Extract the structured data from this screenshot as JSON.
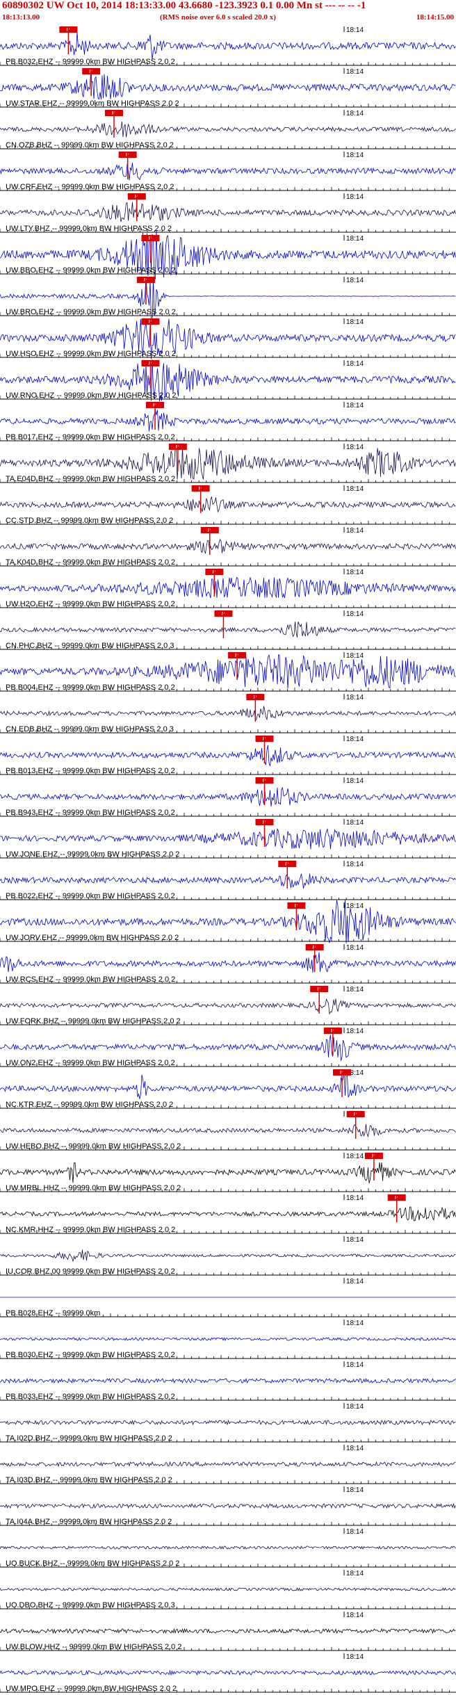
{
  "header": {
    "title": "60890302 UW Oct 10, 2014 18:13:33.00   43.6680 -123.3923  0.1 0.00 Mn st --- -- --  -1",
    "start_time": "18:13:13.00",
    "end_time": "18:14:15.00",
    "subtitle": "(RMS noise over 6.0 s scaled 20.0 x)"
  },
  "colors": {
    "trace_blue": "#0000cc",
    "trace_dark": "#1a0a4a",
    "trace_black": "#000000",
    "pick_marker": "#dd0000",
    "title": "#cc0000"
  },
  "chart_data": {
    "type": "line",
    "x_range": [
      "18:13:13.00",
      "18:14:15.00"
    ],
    "tick_label": "18:14",
    "pick_label": "P",
    "channels": [
      {
        "label": "PB.B032.EHZ -- 99999.0km BW  HIGHPASS  2.0  2",
        "color": "blue",
        "amp": 5,
        "pick": 0.15,
        "events": [
          [
            0.17,
            0.02,
            16
          ],
          [
            0.33,
            0.02,
            16
          ]
        ]
      },
      {
        "label": "UW.STAR.EHZ -- 99999.0km BW  HIGHPASS  2.0  2",
        "color": "blue",
        "amp": 5,
        "pick": 0.2,
        "events": [
          [
            0.22,
            0.05,
            20
          ]
        ]
      },
      {
        "label": "CN.OZB.BHZ -- 99999.0km BW  HIGHPASS  2.0  2",
        "color": "dark",
        "amp": 3,
        "pick": 0.25,
        "events": [
          [
            0.27,
            0.06,
            10
          ]
        ]
      },
      {
        "label": "UW.CRF.EHZ -- 99999.0km BW  HIGHPASS  2.0  2",
        "color": "blue",
        "amp": 4,
        "pick": 0.28,
        "events": [
          [
            0.29,
            0.04,
            10
          ]
        ]
      },
      {
        "label": "UW.LTY.BHZ -- 99999.0km BW  HIGHPASS  2.0  2",
        "color": "dark",
        "amp": 4,
        "pick": 0.3,
        "events": [
          [
            0.3,
            0.08,
            12
          ]
        ]
      },
      {
        "label": "UW.BBO.EHZ -- 99999.0km BW  HIGHPASS  2.0  2",
        "color": "blue",
        "amp": 6,
        "pick": 0.33,
        "events": [
          [
            0.35,
            0.09,
            30
          ]
        ]
      },
      {
        "label": "UW.BRO.EHZ -- 99999.0km BW  HIGHPASS  2.0  2",
        "color": "blue",
        "amp": 3,
        "pick": 0.32,
        "events": [
          [
            0.33,
            0.02,
            40
          ]
        ],
        "flat_after": 0.32
      },
      {
        "label": "UW.HSO.EHZ -- 99999.0km BW  HIGHPASS  2.0  2",
        "color": "blue",
        "amp": 5,
        "pick": 0.33,
        "events": [
          [
            0.34,
            0.08,
            28
          ]
        ]
      },
      {
        "label": "UW.RNO.EHZ -- 99999.0km BW  HIGHPASS  2.0  2",
        "color": "blue",
        "amp": 5,
        "pick": 0.33,
        "events": [
          [
            0.35,
            0.08,
            28
          ]
        ]
      },
      {
        "label": "PB.B017.EHZ -- 99999.0km BW  HIGHPASS  2.0  2",
        "color": "blue",
        "amp": 4,
        "pick": 0.34,
        "events": [
          [
            0.34,
            0.03,
            14
          ]
        ]
      },
      {
        "label": "TA.E04D.BHZ -- 99999.0km BW  HIGHPASS  2.0  2",
        "color": "dark",
        "amp": 5,
        "pick": 0.39,
        "events": [
          [
            0.42,
            0.12,
            20
          ],
          [
            0.84,
            0.05,
            18
          ]
        ]
      },
      {
        "label": "CC.STD.BHZ -- 99999.0km BW  HIGHPASS  2.0  2",
        "color": "dark",
        "amp": 4,
        "pick": 0.44,
        "events": [
          [
            0.45,
            0.04,
            10
          ]
        ]
      },
      {
        "label": "TA.K04D.BHZ -- 99999.0km BW  HIGHPASS  2.0  2",
        "color": "dark",
        "amp": 4,
        "pick": 0.46,
        "events": [
          [
            0.47,
            0.04,
            8
          ]
        ]
      },
      {
        "label": "UW.H2O.EHZ -- 99999.0km BW  HIGHPASS  2.0  2",
        "color": "blue",
        "amp": 4,
        "pick": 0.47,
        "events": [
          [
            0.55,
            0.25,
            12
          ]
        ]
      },
      {
        "label": "CN.PHC.BHZ -- 99999.0km BW  HIGHPASS  2.0  3",
        "color": "dark",
        "amp": 3,
        "pick": 0.49,
        "events": [
          [
            0.66,
            0.04,
            12
          ]
        ]
      },
      {
        "label": "PB.B004.EHZ -- 99999.0km BW  HIGHPASS  2.0  2",
        "color": "blue",
        "amp": 5,
        "pick": 0.52,
        "events": [
          [
            0.6,
            0.2,
            20
          ],
          [
            0.83,
            0.12,
            20
          ]
        ]
      },
      {
        "label": "CN.EDB.BHZ -- 99999.0km BW  HIGHPASS  2.0  3",
        "color": "dark",
        "amp": 3,
        "pick": 0.56,
        "events": [
          [
            0.57,
            0.04,
            8
          ]
        ]
      },
      {
        "label": "PB.B013.EHZ -- 99999.0km BW  HIGHPASS  2.0  2",
        "color": "blue",
        "amp": 4,
        "pick": 0.58,
        "events": [
          [
            0.59,
            0.04,
            12
          ]
        ]
      },
      {
        "label": "PB.B943.EHZ -- 99999.0km BW  HIGHPASS  2.0  2",
        "color": "blue",
        "amp": 4,
        "pick": 0.58,
        "events": [
          [
            0.6,
            0.05,
            14
          ]
        ]
      },
      {
        "label": "UW.JONE.EHZ -- 99999.0km BW  HIGHPASS  2.0  2",
        "color": "blue",
        "amp": 4,
        "pick": 0.58,
        "events": [
          [
            0.7,
            0.2,
            12
          ]
        ]
      },
      {
        "label": "PB.B022.EHZ -- 99999.0km BW  HIGHPASS  2.0  2",
        "color": "blue",
        "amp": 4,
        "pick": 0.63,
        "events": [
          [
            0.65,
            0.04,
            10
          ]
        ]
      },
      {
        "label": "UW.JORV.EHZ -- 99999.0km BW  HIGHPASS  2.0  2",
        "color": "blue",
        "amp": 5,
        "pick": 0.65,
        "events": [
          [
            0.75,
            0.08,
            30
          ]
        ]
      },
      {
        "label": "UW.RCS.EHZ -- 99999.0km BW  HIGHPASS  2.0  2",
        "color": "blue",
        "amp": 4,
        "pick": 0.69,
        "events": [
          [
            0.7,
            0.03,
            14
          ],
          [
            0.02,
            0.02,
            10
          ]
        ]
      },
      {
        "label": "UW.FORK.BHZ -- 99999.0km BW  HIGHPASS  2.0  2",
        "color": "dark",
        "amp": 3,
        "pick": 0.7,
        "events": [
          [
            0.72,
            0.03,
            10
          ]
        ]
      },
      {
        "label": "UW.ON2.EHZ -- 99999.0km BW  HIGHPASS  2.0  2",
        "color": "blue",
        "amp": 4,
        "pick": 0.73,
        "events": [
          [
            0.74,
            0.03,
            18
          ]
        ]
      },
      {
        "label": "NC.KTR.EHZ -- 99999.0km BW  HIGHPASS  2.0  2",
        "color": "blue",
        "amp": 4,
        "pick": 0.75,
        "events": [
          [
            0.76,
            0.02,
            18
          ],
          [
            0.31,
            0.01,
            18
          ]
        ]
      },
      {
        "label": "UW.HEBO.BHZ -- 99999.0km BW  HIGHPASS  2.0  2",
        "color": "dark",
        "amp": 3,
        "pick": 0.78,
        "events": [
          [
            0.8,
            0.03,
            10
          ]
        ]
      },
      {
        "label": "UW.MRBL.HHZ -- 99999.0km BW  HIGHPASS  2.0  2",
        "color": "black",
        "amp": 4,
        "pick": 0.82,
        "events": [
          [
            0.82,
            0.03,
            14
          ],
          [
            0.16,
            0.01,
            12
          ]
        ]
      },
      {
        "label": "NC.KMR.HHZ -- 99999.0km BW  HIGHPASS  2.0  2",
        "color": "black",
        "amp": 3,
        "pick": 0.87,
        "events": [
          [
            0.93,
            0.06,
            10
          ]
        ]
      },
      {
        "label": "IU.COR.BHZ.00 99999.0km BW  HIGHPASS  2.0  2",
        "color": "dark",
        "amp": 2,
        "events": [
          [
            0.17,
            0.04,
            7
          ]
        ]
      },
      {
        "label": "PB.B028.EHZ -- 99999.0km",
        "color": "blue",
        "amp": 0,
        "events": []
      },
      {
        "label": "PB.B030.EHZ -- 99999.0km BW  HIGHPASS  2.0  2",
        "color": "blue",
        "amp": 2,
        "events": []
      },
      {
        "label": "PB.B033.EHZ -- 99999.0km BW  HIGHPASS  2.0  2",
        "color": "blue",
        "amp": 3,
        "events": []
      },
      {
        "label": "TA.I02D.BHZ -- 99999.0km BW  HIGHPASS  2.0  2",
        "color": "dark",
        "amp": 3,
        "events": []
      },
      {
        "label": "TA.I03D.BHZ -- 99999.0km BW  HIGHPASS  2.0  2",
        "color": "dark",
        "amp": 3,
        "events": []
      },
      {
        "label": "TA.I04A.BHZ -- 99999.0km BW  HIGHPASS  2.0  2",
        "color": "dark",
        "amp": 3,
        "events": []
      },
      {
        "label": "UO.BUCK.BHZ -- 99999.0km BW  HIGHPASS  2.0  2",
        "color": "dark",
        "amp": 2,
        "events": []
      },
      {
        "label": "UO.DBO.BHZ -- 99999.0km BW  HIGHPASS  2.0  3",
        "color": "dark",
        "amp": 2,
        "events": []
      },
      {
        "label": "UW.BLOW.HHZ -- 99999.0km BW  HIGHPASS  2.0  2",
        "color": "black",
        "amp": 3,
        "events": []
      },
      {
        "label": "UW.MPO.EHZ -- 99999.0km BW  HIGHPASS  2.0  2",
        "color": "blue",
        "amp": 3,
        "events": []
      }
    ]
  }
}
